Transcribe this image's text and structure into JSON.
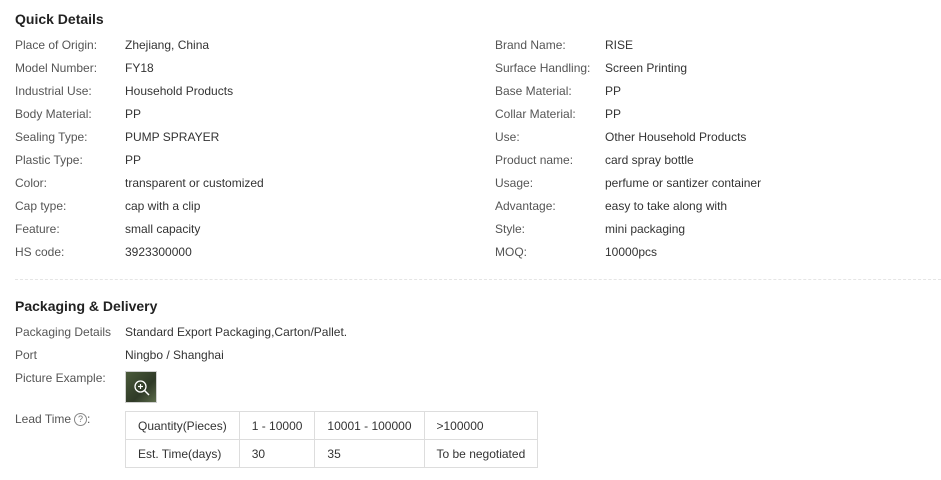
{
  "quick_details": {
    "title": "Quick Details",
    "rows": [
      {
        "left": {
          "label": "Place of Origin:",
          "value": "Zhejiang, China"
        },
        "right": {
          "label": "Brand Name:",
          "value": "RISE"
        }
      },
      {
        "left": {
          "label": "Model Number:",
          "value": "FY18"
        },
        "right": {
          "label": "Surface Handling:",
          "value": "Screen Printing"
        }
      },
      {
        "left": {
          "label": "Industrial Use:",
          "value": "Household Products"
        },
        "right": {
          "label": "Base Material:",
          "value": "PP"
        }
      },
      {
        "left": {
          "label": "Body Material:",
          "value": "PP"
        },
        "right": {
          "label": "Collar Material:",
          "value": "PP"
        }
      },
      {
        "left": {
          "label": "Sealing Type:",
          "value": "PUMP SPRAYER"
        },
        "right": {
          "label": "Use:",
          "value": "Other Household Products"
        }
      },
      {
        "left": {
          "label": "Plastic Type:",
          "value": "PP"
        },
        "right": {
          "label": "Product name:",
          "value": "card spray bottle"
        }
      },
      {
        "left": {
          "label": "Color:",
          "value": "transparent or customized"
        },
        "right": {
          "label": "Usage:",
          "value": "perfume or santizer container"
        }
      },
      {
        "left": {
          "label": "Cap type:",
          "value": "cap with a clip"
        },
        "right": {
          "label": "Advantage:",
          "value": "easy to take along with"
        }
      },
      {
        "left": {
          "label": "Feature:",
          "value": "small capacity"
        },
        "right": {
          "label": "Style:",
          "value": "mini packaging"
        }
      },
      {
        "left": {
          "label": "HS code:",
          "value": "3923300000"
        },
        "right": {
          "label": "MOQ:",
          "value": "10000pcs"
        }
      }
    ]
  },
  "packaging": {
    "title": "Packaging & Delivery",
    "details_label": "Packaging Details",
    "details_value": "Standard Export Packaging,Carton/Pallet.",
    "port_label": "Port",
    "port_value": "Ningbo / Shanghai",
    "picture_label": "Picture Example:",
    "picture_icon": "zoom-in-icon",
    "lead_time_label": "Lead Time",
    "help_icon": "?",
    "lead_table": {
      "header": [
        "Quantity(Pieces)",
        "1 - 10000",
        "10001 - 100000",
        ">100000"
      ],
      "row": [
        "Est. Time(days)",
        "30",
        "35",
        "To be negotiated"
      ]
    }
  }
}
